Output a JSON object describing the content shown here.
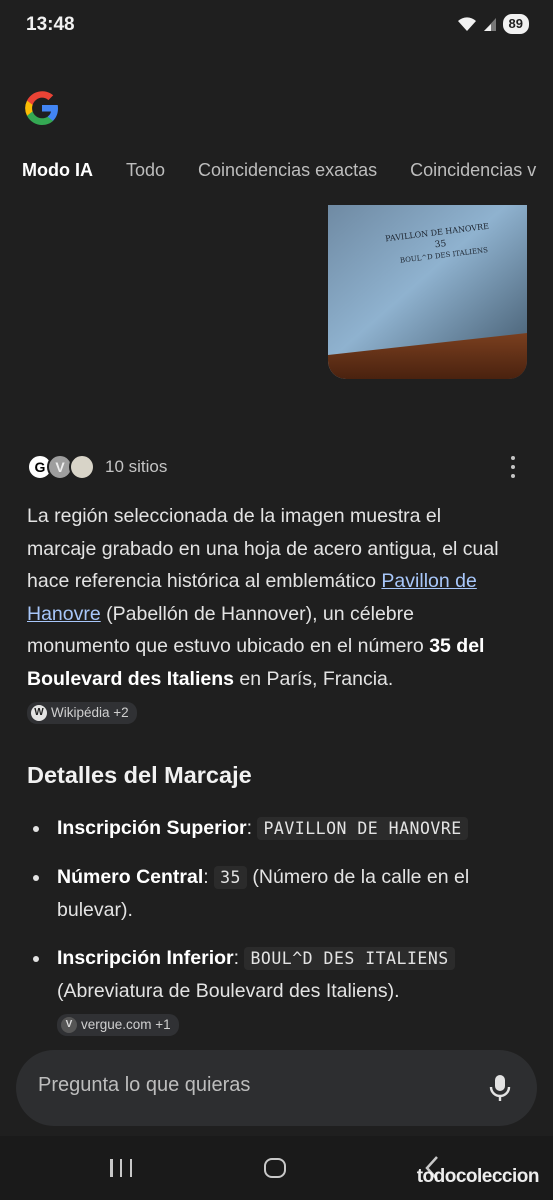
{
  "status": {
    "time": "13:48",
    "battery": "89"
  },
  "tabs": [
    {
      "label": "Modo IA"
    },
    {
      "label": "Todo"
    },
    {
      "label": "Coincidencias exactas"
    },
    {
      "label": "Coincidencias v"
    }
  ],
  "thumb": {
    "engraving_line1": "PAVILLON DE HANOVRE",
    "engraving_line2": "35",
    "engraving_line3": "BOUL^D DES ITALIENS"
  },
  "sources": {
    "label": "10 sitios",
    "favicon_letters": [
      "G",
      "V",
      ""
    ]
  },
  "answer": {
    "text_1": "La región seleccionada de la imagen muestra el marcaje grabado en una hoja de acero antigua, el cual hace referencia histórica al emblemático ",
    "link": "Pavillon de Hanovre",
    "text_2": " (Pabellón de Hannover), un célebre monumento que estuvo ubicado en el número ",
    "bold": "35 del Boulevard des Italiens",
    "text_3": " en París, Francia. ",
    "citation": "Wikipédia +2",
    "citation_icon": "W"
  },
  "details": {
    "heading": "Detalles del Marcaje",
    "items": [
      {
        "label": "Inscripción Superior",
        "sep": ": ",
        "code": "PAVILLON DE HANOVRE",
        "rest": ""
      },
      {
        "label": "Número Central",
        "sep": ": ",
        "code": "35",
        "rest": " (Número de la calle en el bulevar)."
      },
      {
        "label": "Inscripción Inferior",
        "sep": ": ",
        "code": "BOUL^D DES ITALIENS",
        "rest": " (Abreviatura de Boulevard des Italiens). ",
        "citation": "vergue.com +1",
        "citation_icon": "V"
      }
    ]
  },
  "ask": {
    "placeholder": "Pregunta lo que quieras"
  },
  "watermark": "todocoleccion"
}
